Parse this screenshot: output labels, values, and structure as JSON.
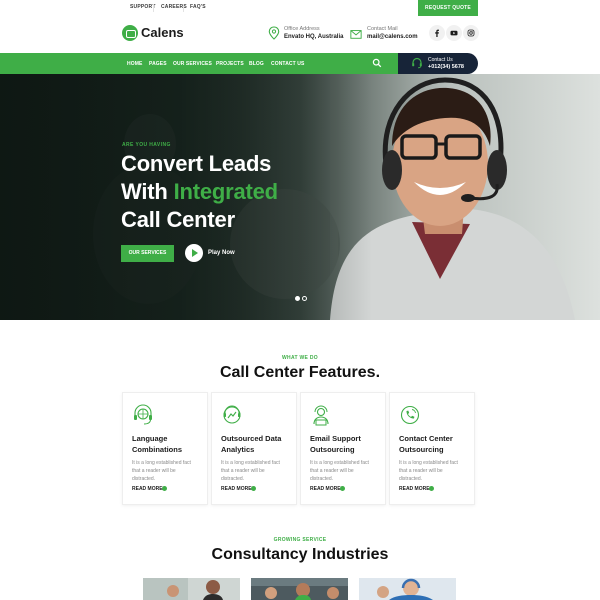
{
  "topbar": {
    "links": [
      "SUPPORT",
      "CAREERS",
      "FAQ'S"
    ],
    "quote_button": "REQUEST QUOTE"
  },
  "header": {
    "logo_text": "Calens",
    "office": {
      "label": "Office Address",
      "value": "Envato HQ, Australia",
      "icon": "location-pin-icon"
    },
    "mail": {
      "label": "Contact Mail",
      "value": "mail@calens.com",
      "icon": "envelope-icon"
    },
    "social_icons": [
      "facebook-icon",
      "youtube-icon",
      "instagram-icon"
    ]
  },
  "nav": {
    "items": [
      "HOME",
      "PAGES",
      "OUR SERVICES",
      "PROJECTS",
      "BLOG",
      "CONTACT US"
    ],
    "search_icon": "search-icon",
    "contact_label": "Contact Us",
    "contact_number": "+012(34) 5678"
  },
  "hero": {
    "eyebrow": "ARE YOU HAVING",
    "line1": "Convert Leads",
    "line2_prefix": "With ",
    "line2_accent": "Integrated",
    "line3": "Call Center",
    "button": "OUR SERVICES",
    "play_label": "Play Now",
    "slider_dots": 2,
    "active_dot": 1
  },
  "features": {
    "eyebrow": "WHAT WE DO",
    "title": "Call Center Features.",
    "cards": [
      {
        "title_1": "Language",
        "title_2": "Combinations",
        "desc": [
          "It is a long established fact",
          "that a reader will be",
          "distracted."
        ],
        "more": "READ MORE",
        "icon": "headset-globe-icon"
      },
      {
        "title_1": "Outsourced Data",
        "title_2": "Analytics",
        "desc": [
          "It is a long established fact",
          "that a reader will be",
          "distracted."
        ],
        "more": "READ MORE",
        "icon": "headset-chart-icon"
      },
      {
        "title_1": "Email Support",
        "title_2": "Outsourcing",
        "desc": [
          "It is a long established fact",
          "that a reader will be",
          "distracted."
        ],
        "more": "READ MORE",
        "icon": "support-agent-icon"
      },
      {
        "title_1": "Contact Center",
        "title_2": "Outsourcing",
        "desc": [
          "It is a long established fact",
          "that a reader will be",
          "distracted."
        ],
        "more": "READ MORE",
        "icon": "phone-call-icon"
      }
    ]
  },
  "consultancy": {
    "eyebrow": "GROWING SERVICE",
    "title": "Consultancy Industries"
  },
  "colors": {
    "accent": "#3fae47",
    "dark_navy": "#172438",
    "text_dark": "#1c1c1c",
    "text_muted": "#8a8a8a"
  }
}
